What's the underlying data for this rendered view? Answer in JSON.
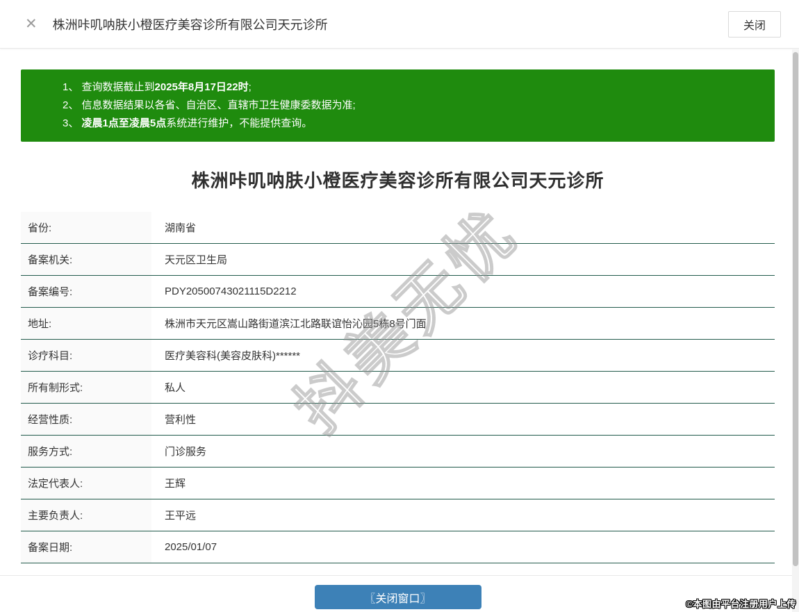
{
  "header": {
    "close_x": "✕",
    "title": "株洲咔叽呐肤小橙医疗美容诊所有限公司天元诊所",
    "close_button_label": "关闭"
  },
  "notice": {
    "items": [
      {
        "pre": "1、 查询数据截止到",
        "bold": "2025年8月17日22时",
        "post": ";"
      },
      {
        "pre": "2、 信息数据结果以各省、自治区、直辖市卫生健康委数据为准;",
        "bold": "",
        "post": ""
      },
      {
        "pre": "3、 ",
        "bold": "凌晨1点至凌晨5点",
        "post": "系统进行维护，不能提供查询。"
      }
    ]
  },
  "main": {
    "title": "株洲咔叽呐肤小橙医疗美容诊所有限公司天元诊所"
  },
  "table": {
    "rows": [
      {
        "label": "省份:",
        "value": "湖南省"
      },
      {
        "label": "备案机关:",
        "value": "天元区卫生局"
      },
      {
        "label": "备案编号:",
        "value": "PDY20500743021115D2212"
      },
      {
        "label": "地址:",
        "value": "株洲市天元区嵩山路街道滨江北路联谊怡沁园5栋8号门面"
      },
      {
        "label": "诊疗科目:",
        "value": "医疗美容科(美容皮肤科)******"
      },
      {
        "label": "所有制形式:",
        "value": "私人"
      },
      {
        "label": "经营性质:",
        "value": "营利性"
      },
      {
        "label": "服务方式:",
        "value": "门诊服务"
      },
      {
        "label": "法定代表人:",
        "value": "王辉"
      },
      {
        "label": "主要负责人:",
        "value": "王平远"
      },
      {
        "label": "备案日期:",
        "value": "2025/01/07"
      }
    ]
  },
  "footer": {
    "close_window_button_label": "〖关闭窗口〗"
  },
  "watermarks": {
    "diagonal": "抖美无忧",
    "corner": "©本图由平台注册用户上传"
  },
  "colors": {
    "notice-green": "#1f8b0e",
    "button-blue": "#3d81b7",
    "divider-teal": "#20594a"
  }
}
